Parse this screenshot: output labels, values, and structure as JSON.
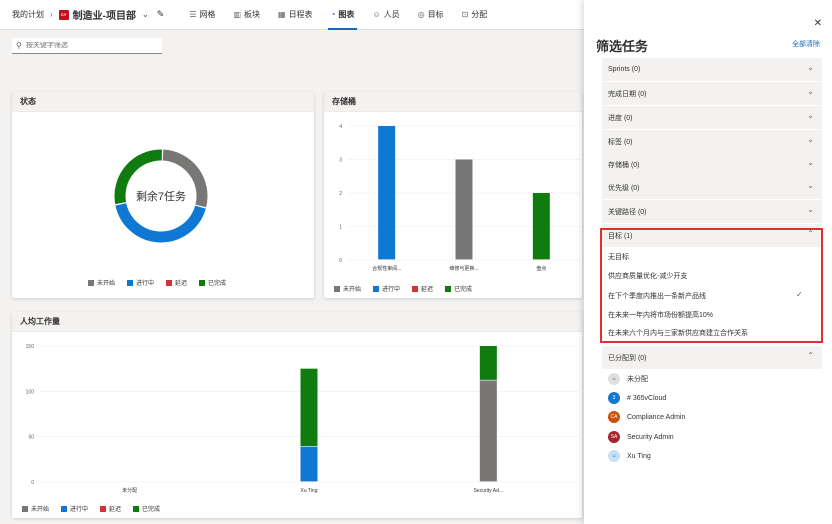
{
  "nav": {
    "breadcrumb": "我的计划",
    "project_icon_text": "CY",
    "project": "制造业-项目部",
    "tabs": [
      {
        "label": "网格",
        "icon": "grid"
      },
      {
        "label": "板块",
        "icon": "board"
      },
      {
        "label": "日程表",
        "icon": "schedule"
      },
      {
        "label": "图表",
        "icon": "charts",
        "active": true
      },
      {
        "label": "人员",
        "icon": "people"
      },
      {
        "label": "目标",
        "icon": "goals"
      },
      {
        "label": "分配",
        "icon": "assign"
      }
    ]
  },
  "search": {
    "placeholder": "按关键字筛选"
  },
  "status_card": {
    "title": "状态",
    "center_text": "剩余7任务",
    "legend": [
      "未开始",
      "进行中",
      "延迟",
      "已完成"
    ]
  },
  "bucket_card": {
    "title": "存储桶",
    "legend": [
      "未开始",
      "进行中",
      "延迟",
      "已完成"
    ]
  },
  "members_card": {
    "title": "人均工作量",
    "legend": [
      "未开始",
      "进行中",
      "延迟",
      "已完成"
    ]
  },
  "colors": {
    "not_started": "#797775",
    "in_progress": "#0f78d4",
    "late": "#d13438",
    "completed": "#107c10"
  },
  "chart_data": [
    {
      "type": "pie",
      "title": "状态",
      "categories": [
        "未开始",
        "进行中",
        "已完成"
      ],
      "values": [
        2,
        3,
        2
      ]
    },
    {
      "type": "bar",
      "title": "存储桶",
      "categories": [
        "合规性审阅...",
        "维修与更换...",
        "盘点"
      ],
      "y_ticks": [
        "0",
        "1",
        "2",
        "3",
        "4"
      ],
      "ylim": [
        0,
        4
      ],
      "series": [
        {
          "name": "进行中",
          "values": [
            4,
            0,
            0
          ]
        },
        {
          "name": "未开始",
          "values": [
            0,
            3,
            0
          ]
        },
        {
          "name": "已完成",
          "values": [
            0,
            0,
            2
          ]
        }
      ]
    },
    {
      "type": "bar",
      "title": "人均工作量",
      "categories": [
        "未分配",
        "Xu Ting",
        "Security Ad..."
      ],
      "y_ticks": [
        "0",
        "50",
        "100",
        "150"
      ],
      "ylim": [
        0,
        150
      ],
      "series": [
        {
          "name": "未开始",
          "values": [
            0,
            0,
            112
          ]
        },
        {
          "name": "进行中",
          "values": [
            0,
            39,
            0
          ]
        },
        {
          "name": "已完成",
          "values": [
            0,
            86,
            38
          ]
        }
      ]
    }
  ],
  "panel": {
    "title": "筛选任务",
    "clear": "全部清除",
    "filters": [
      "Sprints (0)",
      "完成日期 (0)",
      "进度 (0)",
      "标签 (0)",
      "存储桶 (0)",
      "优先级 (0)",
      "关键路径 (0)"
    ],
    "goal_header": "目标 (1)",
    "goal_options": [
      "无目标",
      "供应商质量优化-减少开支",
      "在下个季度内推出一条新产品线",
      "在未来一年内将市场份额提高10%",
      "在未来六个月内与三家新供应商建立合作关系"
    ],
    "assigned_header": "已分配到 (0)",
    "people": [
      {
        "initials": "",
        "name": "未分配",
        "color": "#e1dfdd"
      },
      {
        "initials": "3",
        "name": "# 365vCloud",
        "color": "#0f78d4"
      },
      {
        "initials": "CA",
        "name": "Compliance Admin",
        "color": "#ca5010"
      },
      {
        "initials": "SA",
        "name": "Security Admin",
        "color": "#a4262c"
      },
      {
        "initials": "",
        "name": "Xu Ting",
        "color": "#c7e0f4"
      }
    ]
  }
}
